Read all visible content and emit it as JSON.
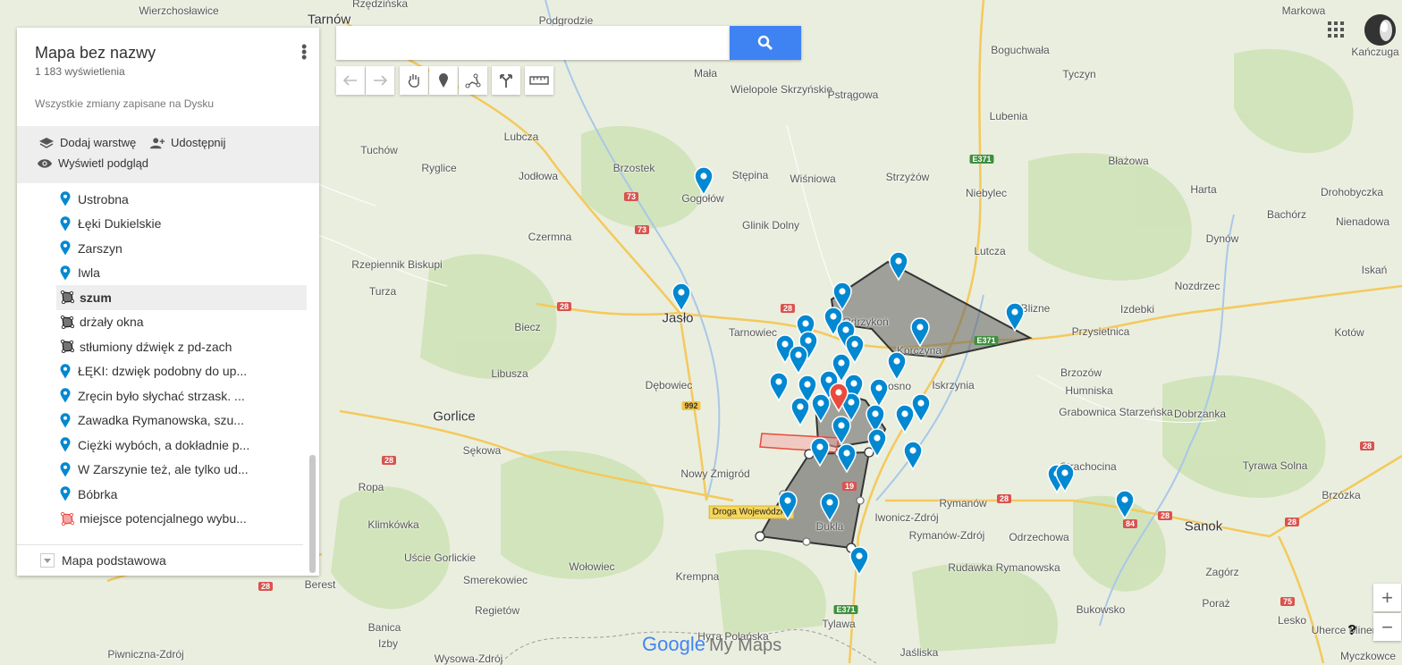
{
  "search": {
    "placeholder": "",
    "value": ""
  },
  "panel": {
    "title": "Mapa bez nazwy",
    "views": "1 183 wyświetlenia",
    "saved": "Wszystkie zmiany zapisane na Dysku",
    "actions": {
      "add_layer": "Dodaj warstwę",
      "share": "Udostępnij",
      "preview": "Wyświetl podgląd"
    },
    "items": [
      {
        "type": "pin",
        "label": "Ustrobna"
      },
      {
        "type": "pin",
        "label": "Łęki Dukielskie"
      },
      {
        "type": "pin",
        "label": "Zarszyn"
      },
      {
        "type": "pin",
        "label": "Iwla"
      },
      {
        "type": "polygon",
        "label": "szum",
        "selected": true
      },
      {
        "type": "polygon",
        "label": "drżały okna"
      },
      {
        "type": "polygon",
        "label": "stłumiony dźwięk z pd-zach"
      },
      {
        "type": "pin",
        "label": "ŁĘKI:  dzwięk podobny do up..."
      },
      {
        "type": "pin",
        "label": "Zręcin było słychać strzask. ..."
      },
      {
        "type": "pin",
        "label": "Zawadka Rymanowska, szu..."
      },
      {
        "type": "pin",
        "label": "Ciężki wybóch, a dokładnie p..."
      },
      {
        "type": "pin",
        "label": "W Zarszynie też, ale tylko ud..."
      },
      {
        "type": "pin",
        "label": "Bóbrka"
      },
      {
        "type": "red-polygon",
        "label": "miejsce potencjalnego wybu..."
      }
    ],
    "basemap": "Mapa podstawowa"
  },
  "map": {
    "places": [
      "Tarnów",
      "Wierzchosławice",
      "Rzędzińska",
      "Podgrodzie",
      "Mała",
      "Wielopole Skrzyńskie",
      "Pstrągowa",
      "Boguchwała",
      "Tyczyn",
      "Markowa",
      "Kańczuga",
      "Lubenia",
      "Lubcza",
      "Tuchów",
      "Ryglice",
      "Brzostek",
      "Stępina",
      "Wiśniowa",
      "Strzyżów",
      "Niebylec",
      "Błażowa",
      "Jodłowa",
      "Gogołów",
      "Glinik Dolny",
      "Harta",
      "Dynów",
      "Bachórz",
      "Drohobyczka",
      "Nienadowa",
      "Czermna",
      "Lutcza",
      "Rzepiennik Biskupi",
      "Turza",
      "Jasło",
      "Tarnowiec",
      "Odrzykoń",
      "Korczyna",
      "Blizne",
      "Izdebki",
      "Nozdrzec",
      "Iskań",
      "Biecz",
      "Przysietnica",
      "Kotów",
      "Libusza",
      "Dębowiec",
      "Krosno",
      "Iskrzynia",
      "Brzozów",
      "Humniska",
      "Grabownica Starzeńska",
      "Dobrzanka",
      "Gorlice",
      "Sękowa",
      "Nowy Żmigród",
      "Strachocina",
      "Tyrawa Solna",
      "Ropa",
      "Rymanów",
      "Sanok",
      "Brzózka",
      "Klimkówka",
      "Uście Gorlickie",
      "Iwonicz-Zdrój",
      "Dukla",
      "Rymanów-Zdrój",
      "Odrzechowa",
      "Wołowiec",
      "Smerekowiec",
      "Krempna",
      "Rudawka Rymanowska",
      "Zagórz",
      "Regietów",
      "Berest",
      "Bukowsko",
      "Poraż",
      "Lesko",
      "Banica",
      "Izby",
      "Tylawa",
      "Piwniczna-Zdrój",
      "Wysowa-Zdrój",
      "Jaśliska",
      "Uherce Mineralne",
      "Myczkowce",
      "Hута Polańska"
    ],
    "road_shields": [
      "E371",
      "73",
      "73",
      "28",
      "28",
      "28",
      "992",
      "19",
      "28",
      "28",
      "28",
      "28",
      "28",
      "75",
      "84",
      "E371",
      "E371"
    ],
    "road_label": "Droga Wojewódzka",
    "logo_google": "Google",
    "logo_suffix": "My Maps"
  },
  "controls": {
    "zoom_in": "+",
    "zoom_out": "−",
    "help": "?"
  },
  "colors": {
    "pin": "#0288d1",
    "red_pin": "#e84b3c",
    "search_button": "#3f82f2",
    "polygon_fill": "#616161"
  }
}
